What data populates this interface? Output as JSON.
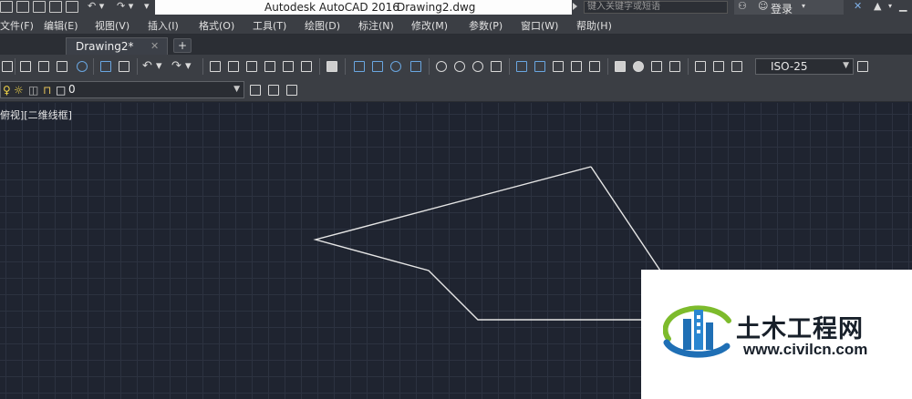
{
  "titlebar": {
    "app_title": "Autodesk AutoCAD 2016",
    "file_title": "Drawing2.dwg",
    "search_placeholder": "键入关键字或短语",
    "login_label": "登录"
  },
  "menu": {
    "items": [
      "文件(F)",
      "编辑(E)",
      "视图(V)",
      "插入(I)",
      "格式(O)",
      "工具(T)",
      "绘图(D)",
      "标注(N)",
      "修改(M)",
      "参数(P)",
      "窗口(W)",
      "帮助(H)"
    ]
  },
  "tabs": {
    "drawing_tab": "Drawing2*",
    "close_glyph": "✕",
    "add_glyph": "+"
  },
  "toolbar": {
    "dim_style": "ISO-25",
    "layer_name": "0"
  },
  "viewport": {
    "label": "俯视][二维线框]"
  },
  "watermark": {
    "site_cn": "土木工程网",
    "site_url": "www.civilcn.com"
  },
  "colors": {
    "canvas_bg": "#1f2430",
    "grid": "#2c3240",
    "linework": "#e6e6e6",
    "ui_dark": "#3b3e44",
    "accent_blue": "#1f6fb5",
    "accent_green": "#7dbb2c"
  }
}
